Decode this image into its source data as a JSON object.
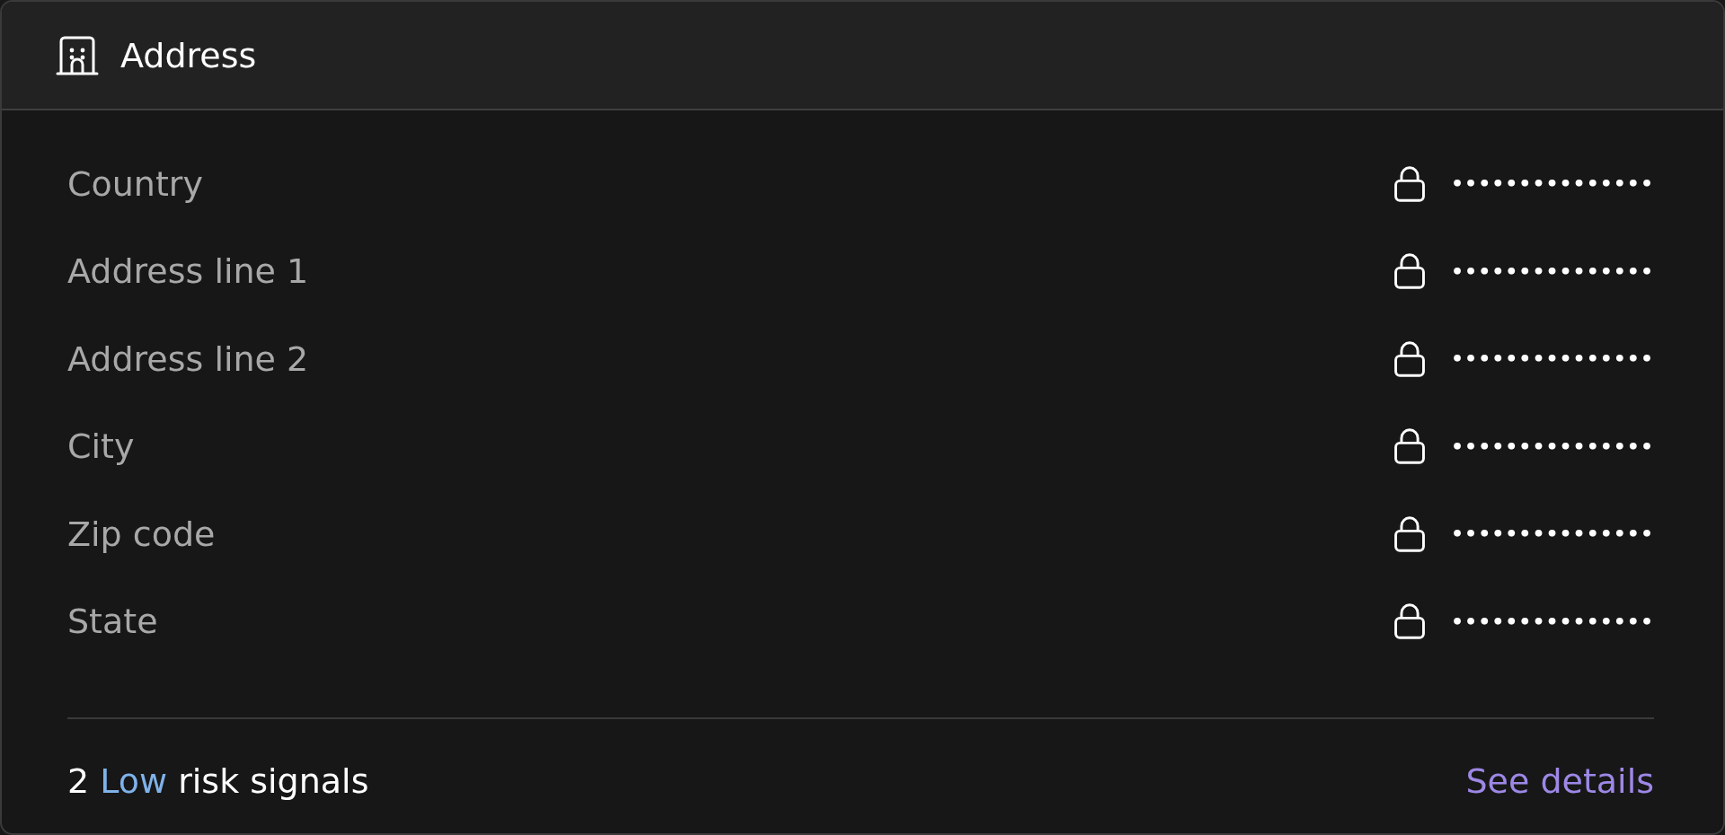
{
  "card": {
    "title": "Address"
  },
  "fields": [
    {
      "label": "Country",
      "value": "•••••••••••••••",
      "locked": true
    },
    {
      "label": "Address line 1",
      "value": "•••••••••••••••",
      "locked": true
    },
    {
      "label": "Address line 2",
      "value": "•••••••••••••••",
      "locked": true
    },
    {
      "label": "City",
      "value": "•••••••••••••••",
      "locked": true
    },
    {
      "label": "Zip code",
      "value": "•••••••••••••••",
      "locked": true
    },
    {
      "label": "State",
      "value": "•••••••••••••••",
      "locked": true
    }
  ],
  "footer": {
    "count": "2",
    "risk_level": "Low",
    "color": "#7fb2ea",
    "suffix": "risk signals",
    "link": "See details"
  }
}
